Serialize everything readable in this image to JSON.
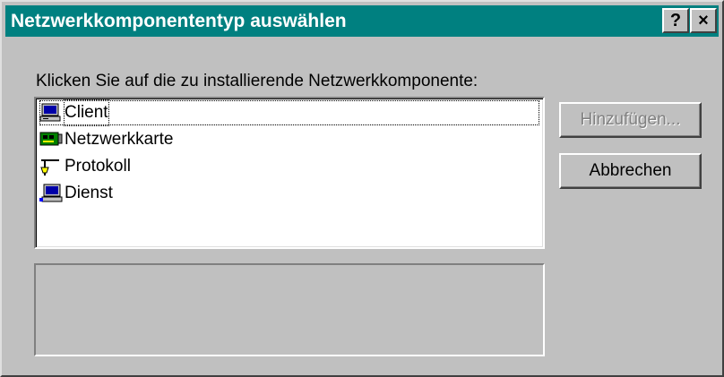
{
  "dialog": {
    "title": "Netzwerkkomponententyp auswählen",
    "help_label": "?",
    "close_label": "×",
    "prompt": "Klicken Sie auf die zu installierende Netzwerkkomponente:",
    "items": [
      {
        "label": "Client",
        "icon": "client-computer-icon"
      },
      {
        "label": "Netzwerkkarte",
        "icon": "network-card-icon"
      },
      {
        "label": "Protokoll",
        "icon": "protocol-icon"
      },
      {
        "label": "Dienst",
        "icon": "service-computer-icon"
      }
    ],
    "description": "",
    "add_button": "Hinzufügen...",
    "cancel_button": "Abbrechen"
  },
  "colors": {
    "titlebar": "#008080",
    "face": "#c0c0c0"
  }
}
